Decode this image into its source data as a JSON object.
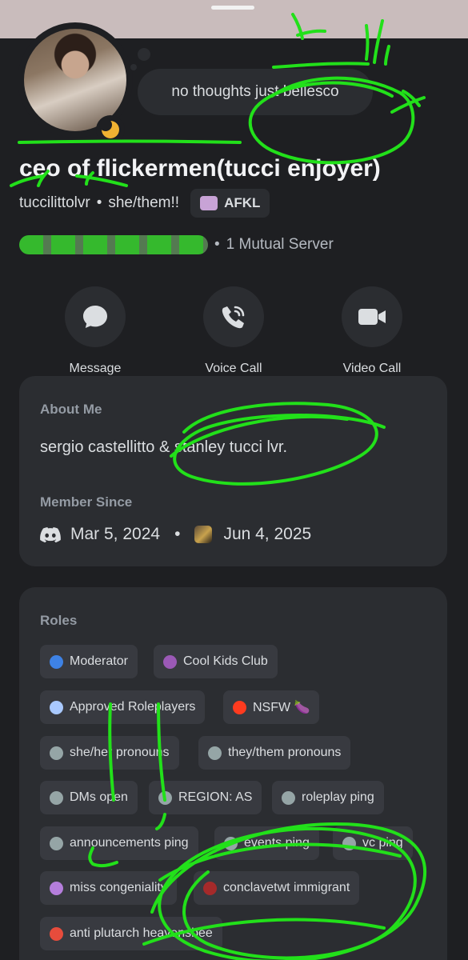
{
  "profile": {
    "display_name": "ceo of flickermen(tucci enjoyer)",
    "username": "tuccilittolvr",
    "separator": "•",
    "pronouns": "she/them!!",
    "clan_tag": "AFKL",
    "custom_status": "no thoughts just bellesco",
    "status": "idle",
    "mutual_servers": "1 Mutual Server"
  },
  "actions": [
    {
      "label": "Message",
      "icon": "message-icon"
    },
    {
      "label": "Voice Call",
      "icon": "phone-icon"
    },
    {
      "label": "Video Call",
      "icon": "video-camera-icon"
    }
  ],
  "about": {
    "title": "About Me",
    "text": "sergio castellitto & stanley tucci lvr.",
    "member_since_title": "Member Since",
    "discord_join": "Mar 5, 2024",
    "server_join": "Jun 4, 2025",
    "separator": "•"
  },
  "roles": {
    "title": "Roles",
    "items": [
      {
        "name": "Moderator",
        "color": "#3e82e5"
      },
      {
        "name": "Cool Kids Club",
        "color": "#9b59b6"
      },
      {
        "name": "Approved Roleplayers",
        "color": "#a9c9ff"
      },
      {
        "name": "NSFW 🍆",
        "color": "#ff3b1f"
      },
      {
        "name": "she/her pronouns",
        "color": "#95a5a6"
      },
      {
        "name": "they/them pronouns",
        "color": "#95a5a6"
      },
      {
        "name": "DMs open",
        "color": "#95a5a6"
      },
      {
        "name": "REGION: AS",
        "color": "#95a5a6"
      },
      {
        "name": "roleplay ping",
        "color": "#95a5a6"
      },
      {
        "name": "announcements ping",
        "color": "#95a5a6"
      },
      {
        "name": "events ping",
        "color": "#95a5a6"
      },
      {
        "name": "vc ping",
        "color": "#95a5a6"
      },
      {
        "name": "miss congeniality",
        "color": "#b57edc"
      },
      {
        "name": "conclavetwt immigrant",
        "color": "#a52a2a"
      },
      {
        "name": "anti plutarch heavensbee",
        "color": "#e74c3c"
      }
    ]
  },
  "colors": {
    "background": "#1e1f22",
    "card": "#2b2d31",
    "chip": "#383a40",
    "idle": "#f0b232",
    "scribble": "#22e01a"
  }
}
